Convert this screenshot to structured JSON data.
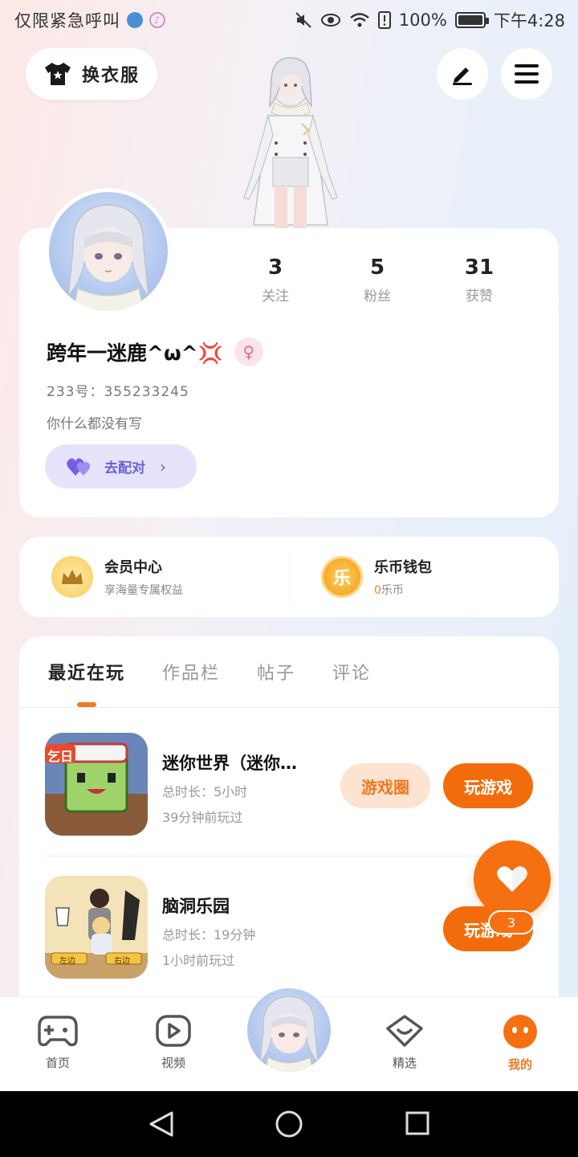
{
  "status_bar": {
    "left_text": "仅限紧急呼叫",
    "right_text": "100%",
    "time": "下午4:28"
  },
  "header": {
    "outfit_label": "换衣服",
    "edit_icon": "pen-icon",
    "menu_icon": "menu-icon"
  },
  "profile": {
    "stats": [
      {
        "value": "3",
        "label": "关注"
      },
      {
        "value": "5",
        "label": "粉丝"
      },
      {
        "value": "31",
        "label": "获赞"
      }
    ],
    "username": "跨年一迷鹿^ω^💢",
    "gender_symbol": "♀",
    "uid_label": "233号：355233245",
    "bio": "你什么都没有写",
    "pair_label": "去配对",
    "pair_chevron": "›"
  },
  "member_wallet": {
    "member_title": "会员中心",
    "member_sub": "享海量专属权益",
    "wallet_title": "乐币钱包",
    "wallet_icon_text": "乐",
    "wallet_amount": "0",
    "wallet_unit": "乐币"
  },
  "tabs": [
    {
      "label": "最近在玩"
    },
    {
      "label": "作品栏"
    },
    {
      "label": "帖子"
    },
    {
      "label": "评论"
    }
  ],
  "games": [
    {
      "title": "迷你世界（迷你…",
      "duration": "总时长：5小时",
      "last_played": "39分钟前玩过",
      "circle_label": "游戏圈",
      "play_label": "玩游戏",
      "icon_badge": "乞日"
    },
    {
      "title": "脑洞乐园",
      "duration": "总时长：19分钟",
      "last_played": "1小时前玩过",
      "play_label": "玩游戏",
      "icon_left": "左边",
      "icon_right": "右边"
    }
  ],
  "floating": {
    "count": "3"
  },
  "bottom_nav": [
    {
      "label": "首页",
      "icon": "gamepad-icon"
    },
    {
      "label": "视频",
      "icon": "play-icon"
    },
    {
      "label": "精选",
      "icon": "heart-box-icon"
    },
    {
      "label": "我的",
      "icon": "face-icon"
    }
  ],
  "colors": {
    "accent": "#f36c0c",
    "pair": "#6d5fd9"
  }
}
